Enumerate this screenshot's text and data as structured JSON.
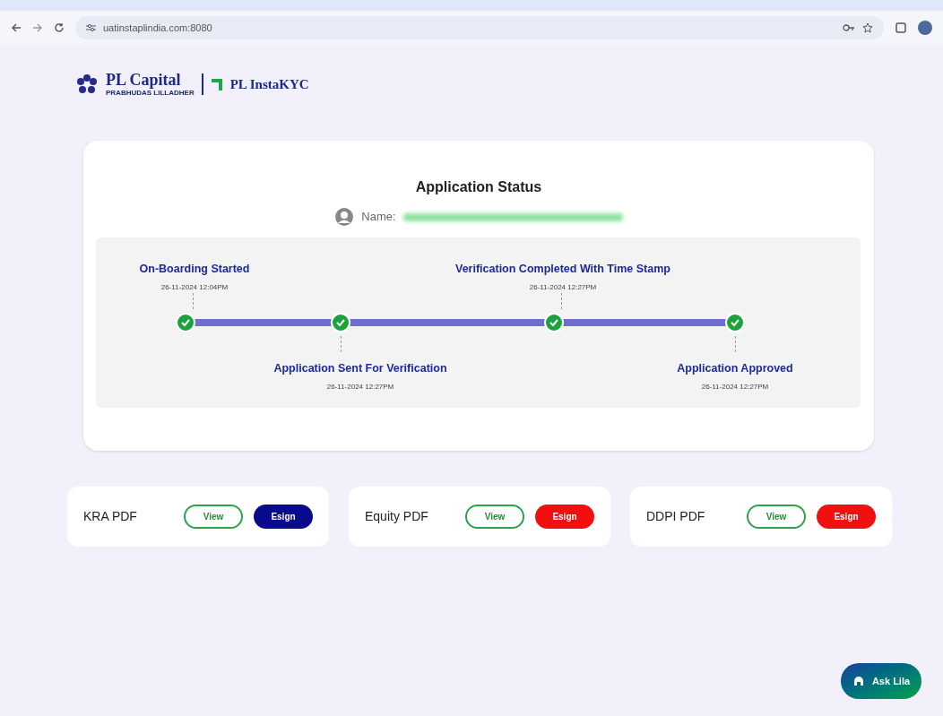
{
  "browser": {
    "url": "uatinstaplindia.com:8080"
  },
  "logo": {
    "brand": "PL Capital",
    "tagline": "PRABHUDAS LILLADHER",
    "product": "PL InstaKYC"
  },
  "status_card": {
    "title": "Application Status",
    "name_label": "Name:",
    "steps": [
      {
        "label": "On-Boarding Started",
        "time": "26-11-2024 12:04PM",
        "kind": "above",
        "completed": true
      },
      {
        "label": "Application Sent For Verification",
        "time": "26-11-2024 12:27PM",
        "kind": "below",
        "completed": true
      },
      {
        "label": "Verification Completed With Time Stamp",
        "time": "26-11-2024 12:27PM",
        "kind": "above",
        "completed": true
      },
      {
        "label": "Application Approved",
        "time": "26-11-2024 12:27PM",
        "kind": "below",
        "completed": true
      }
    ]
  },
  "documents": [
    {
      "name": "KRA PDF",
      "view": "View",
      "esign": "Esign",
      "color": "#0a0a8c"
    },
    {
      "name": "Equity PDF",
      "view": "View",
      "esign": "Esign",
      "color": "#f01010"
    },
    {
      "name": "DDPI PDF",
      "view": "View",
      "esign": "Esign",
      "color": "#f01010"
    }
  ],
  "assistant_button": {
    "label": "Ask Lila"
  }
}
